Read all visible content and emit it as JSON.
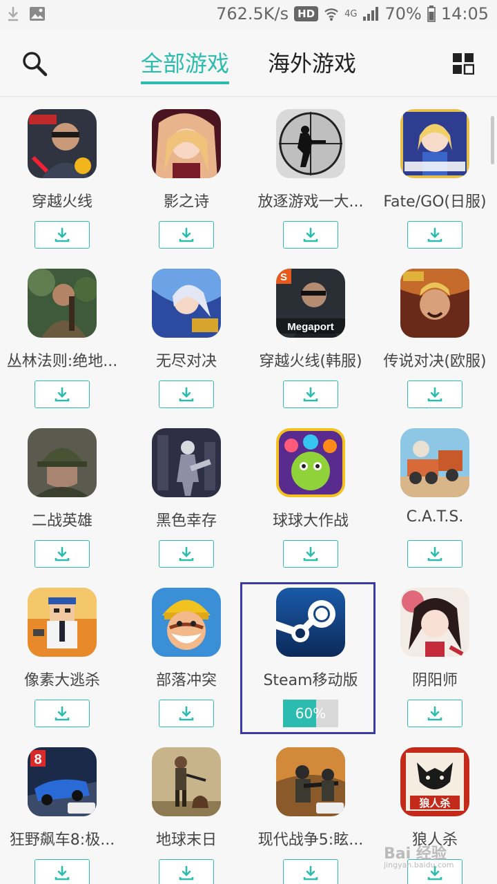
{
  "status": {
    "speed": "762.5K/s",
    "hd": "HD",
    "network": "4G",
    "battery": "70%",
    "time": "14:05"
  },
  "header": {
    "tabs": [
      {
        "label": "全部游戏",
        "active": true
      },
      {
        "label": "海外游戏",
        "active": false
      }
    ],
    "accent_color": "#2bbcaf"
  },
  "games": [
    {
      "name": "穿越火线",
      "icon": "cf-soldier-icon"
    },
    {
      "name": "影之诗",
      "icon": "shadowverse-girl-icon"
    },
    {
      "name": "放逐游戏一大...",
      "icon": "sniper-crosshair-icon"
    },
    {
      "name": "Fate/GO(日服)",
      "icon": "fate-grand-order-icon"
    },
    {
      "name": "丛林法则:绝地...",
      "icon": "jungle-survivor-icon"
    },
    {
      "name": "无尽对决",
      "icon": "mobile-legends-icon"
    },
    {
      "name": "穿越火线(韩服)",
      "icon": "megaport-cf-icon",
      "badge": "Megaport"
    },
    {
      "name": "传说对决(欧服)",
      "icon": "arena-of-valor-icon"
    },
    {
      "name": "二战英雄",
      "icon": "ww2-soldier-icon"
    },
    {
      "name": "黑色幸存",
      "icon": "dark-survivor-icon"
    },
    {
      "name": "球球大作战",
      "icon": "ball-battle-icon"
    },
    {
      "name": "C.A.T.S.",
      "icon": "cats-robot-car-icon"
    },
    {
      "name": "像素大逃杀",
      "icon": "pixel-battle-icon"
    },
    {
      "name": "部落冲突",
      "icon": "clash-of-clans-icon"
    },
    {
      "name": "Steam移动版",
      "icon": "steam-icon",
      "progress": 60,
      "progress_label": "60%"
    },
    {
      "name": "阴阳师",
      "icon": "onmyoji-icon"
    },
    {
      "name": "狂野飙车8:极...",
      "icon": "asphalt-8-icon",
      "badge": "8"
    },
    {
      "name": "地球末日",
      "icon": "last-day-on-earth-icon"
    },
    {
      "name": "现代战争5:眩...",
      "icon": "modern-combat-5-icon"
    },
    {
      "name": "狼人杀",
      "icon": "werewolf-icon",
      "badge": "狼人杀"
    }
  ],
  "watermark": {
    "text": "Bai 经验",
    "sub": "jingyan.baidu.com"
  }
}
